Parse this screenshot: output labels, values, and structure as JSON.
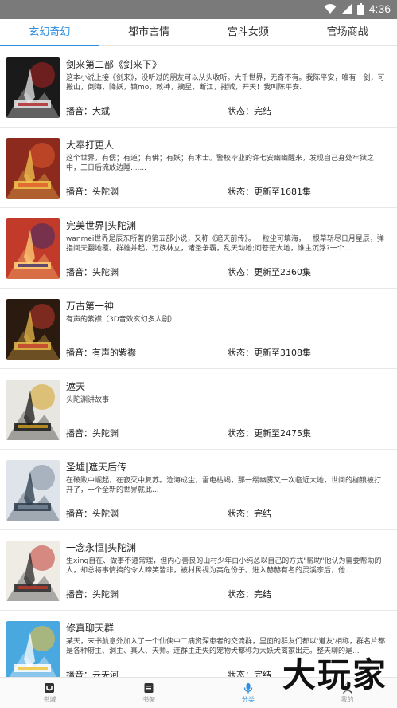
{
  "status": {
    "time": "4:36"
  },
  "tabs": [
    {
      "label": "玄幻奇幻",
      "active": true
    },
    {
      "label": "都市言情",
      "active": false
    },
    {
      "label": "宫斗女频",
      "active": false
    },
    {
      "label": "官场商战",
      "active": false
    }
  ],
  "items": [
    {
      "title": "剑来第二部《剑来下》",
      "desc": "这本小说上接《剑来》，没听过的朋友可以从头收听。大千世界，无奇不有。我陈平安，唯有一剑，可搬山，倒海，降妖，镇mo，敕神，摘星，断江，摧城，开天！我叫陈平安.",
      "anchor": "播音：大斌",
      "state": "状态：完结",
      "cover": {
        "bg": "#1a1a1a",
        "fg": "#e8e8e8",
        "accent": "#b22222"
      }
    },
    {
      "title": "大奉打更人",
      "desc": "这个世界，有儒；有道；有佛；有妖；有术士。警校毕业的许七安幽幽醒来，发现自己身处牢狱之中，三日后流放边陲.......",
      "anchor": "播音：头陀渊",
      "state": "状态：更新至1681集",
      "cover": {
        "bg": "#8c2a1e",
        "fg": "#f2c64d",
        "accent": "#e05a2c"
      }
    },
    {
      "title": "完美世界|头陀渊",
      "desc": "wanmei世界是辰东所著的第五部小说，又称《遮天前传》。一粒尘可填海，一根草斩尽日月星辰，弹指间天翻地覆。群雄并起，万族林立，诸圣争霸，乱天动地;问苍茫大地，谁主沉浮?一个...",
      "anchor": "播音：头陀渊",
      "state": "状态：更新至2360集",
      "cover": {
        "bg": "#c23a2a",
        "fg": "#ffd27a",
        "accent": "#3a2a6a"
      }
    },
    {
      "title": "万古第一神",
      "desc": "有声的紫襟（3D音效玄幻多人剧）",
      "anchor": "播音：有声的紫襟",
      "state": "状态：更新至3108集",
      "cover": {
        "bg": "#2a1a10",
        "fg": "#e8b84a",
        "accent": "#c0392b"
      }
    },
    {
      "title": "遮天",
      "desc": "头陀渊讲故事",
      "anchor": "播音：头陀渊",
      "state": "状态：更新至2475集",
      "cover": {
        "bg": "#e8e6e0",
        "fg": "#1a1a1a",
        "accent": "#d4a020"
      }
    },
    {
      "title": "圣墟|遮天后传",
      "desc": "在破败中崛起，在寂灭中复苏。沧海成尘，雷电枯竭，那一缕幽雾又一次临近大地，世间的枷锁被打开了，一个全新的世界就此...",
      "anchor": "播音：头陀渊",
      "state": "状态：完结",
      "cover": {
        "bg": "#dfe4ea",
        "fg": "#2a3a4a",
        "accent": "#7a8a9a"
      }
    },
    {
      "title": "一念永恒|头陀渊",
      "desc": "生xing自在、做事不遵常理，但内心善良的山村少年白小纯怂以自己的方式\"帮助\"他认为需要帮助的人，却总将事情搞的令人啼笑皆非，被村民视为高危份子。进入赫赫有名的灵溪宗后，他...",
      "anchor": "播音：头陀渊",
      "state": "状态：完结",
      "cover": {
        "bg": "#efece6",
        "fg": "#2a2a2a",
        "accent": "#c0392b"
      }
    },
    {
      "title": "修真聊天群",
      "desc": "某天，宋书航意外加入了一个仙侠中二病资深患者的交流群，里面的群友们都以'道友'相称，群名片都是各种府主、洞主、真人、天师。连群主走失的宠物犬都称为大妖犬离家出走。整天聊的是...",
      "anchor": "播音：云天河",
      "state": "状态：完结",
      "cover": {
        "bg": "#4aa8e0",
        "fg": "#ffffff",
        "accent": "#f2c12e"
      }
    }
  ],
  "bottom_nav": [
    {
      "label": "书城",
      "icon": "bookstore-icon",
      "active": false
    },
    {
      "label": "书架",
      "icon": "bookshelf-icon",
      "active": false
    },
    {
      "label": "分类",
      "icon": "microphone-icon",
      "active": true
    },
    {
      "label": "我的",
      "icon": "profile-icon",
      "active": false
    }
  ],
  "watermark": "大玩家",
  "colors": {
    "accent": "#2e8fe0",
    "status_bar": "#7a7a7a"
  }
}
